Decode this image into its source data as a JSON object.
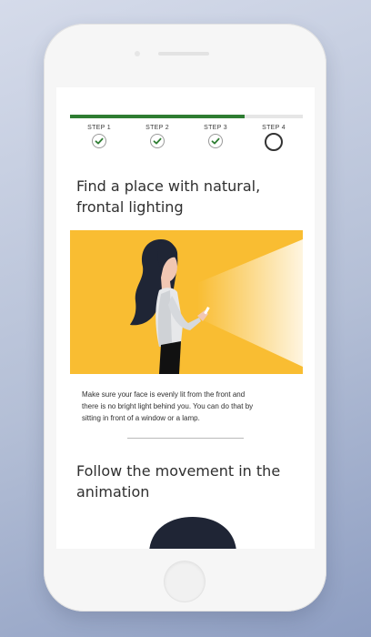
{
  "progress": {
    "fraction": 0.75
  },
  "steps": [
    {
      "label": "STEP 1",
      "status": "complete"
    },
    {
      "label": "STEP 2",
      "status": "complete"
    },
    {
      "label": "STEP 3",
      "status": "complete"
    },
    {
      "label": "STEP 4",
      "status": "current"
    }
  ],
  "section1": {
    "title_line1": "Find a place with natural,",
    "title_line2": "frontal lighting",
    "description_line1": "Make sure your face is evenly lit from the front and",
    "description_line2": "there is no bright light behind you. You can do that by",
    "description_line3": "sitting in front of a window or a lamp."
  },
  "section2": {
    "title_line1": "Follow the movement in the",
    "title_line2": "animation"
  },
  "colors": {
    "accent_green": "#2e7d32",
    "illustration_yellow": "#f9bd32",
    "hair_navy": "#1f2535"
  },
  "icons": [
    "check-icon",
    "woman-with-phone-illustration",
    "light-beam-icon"
  ]
}
